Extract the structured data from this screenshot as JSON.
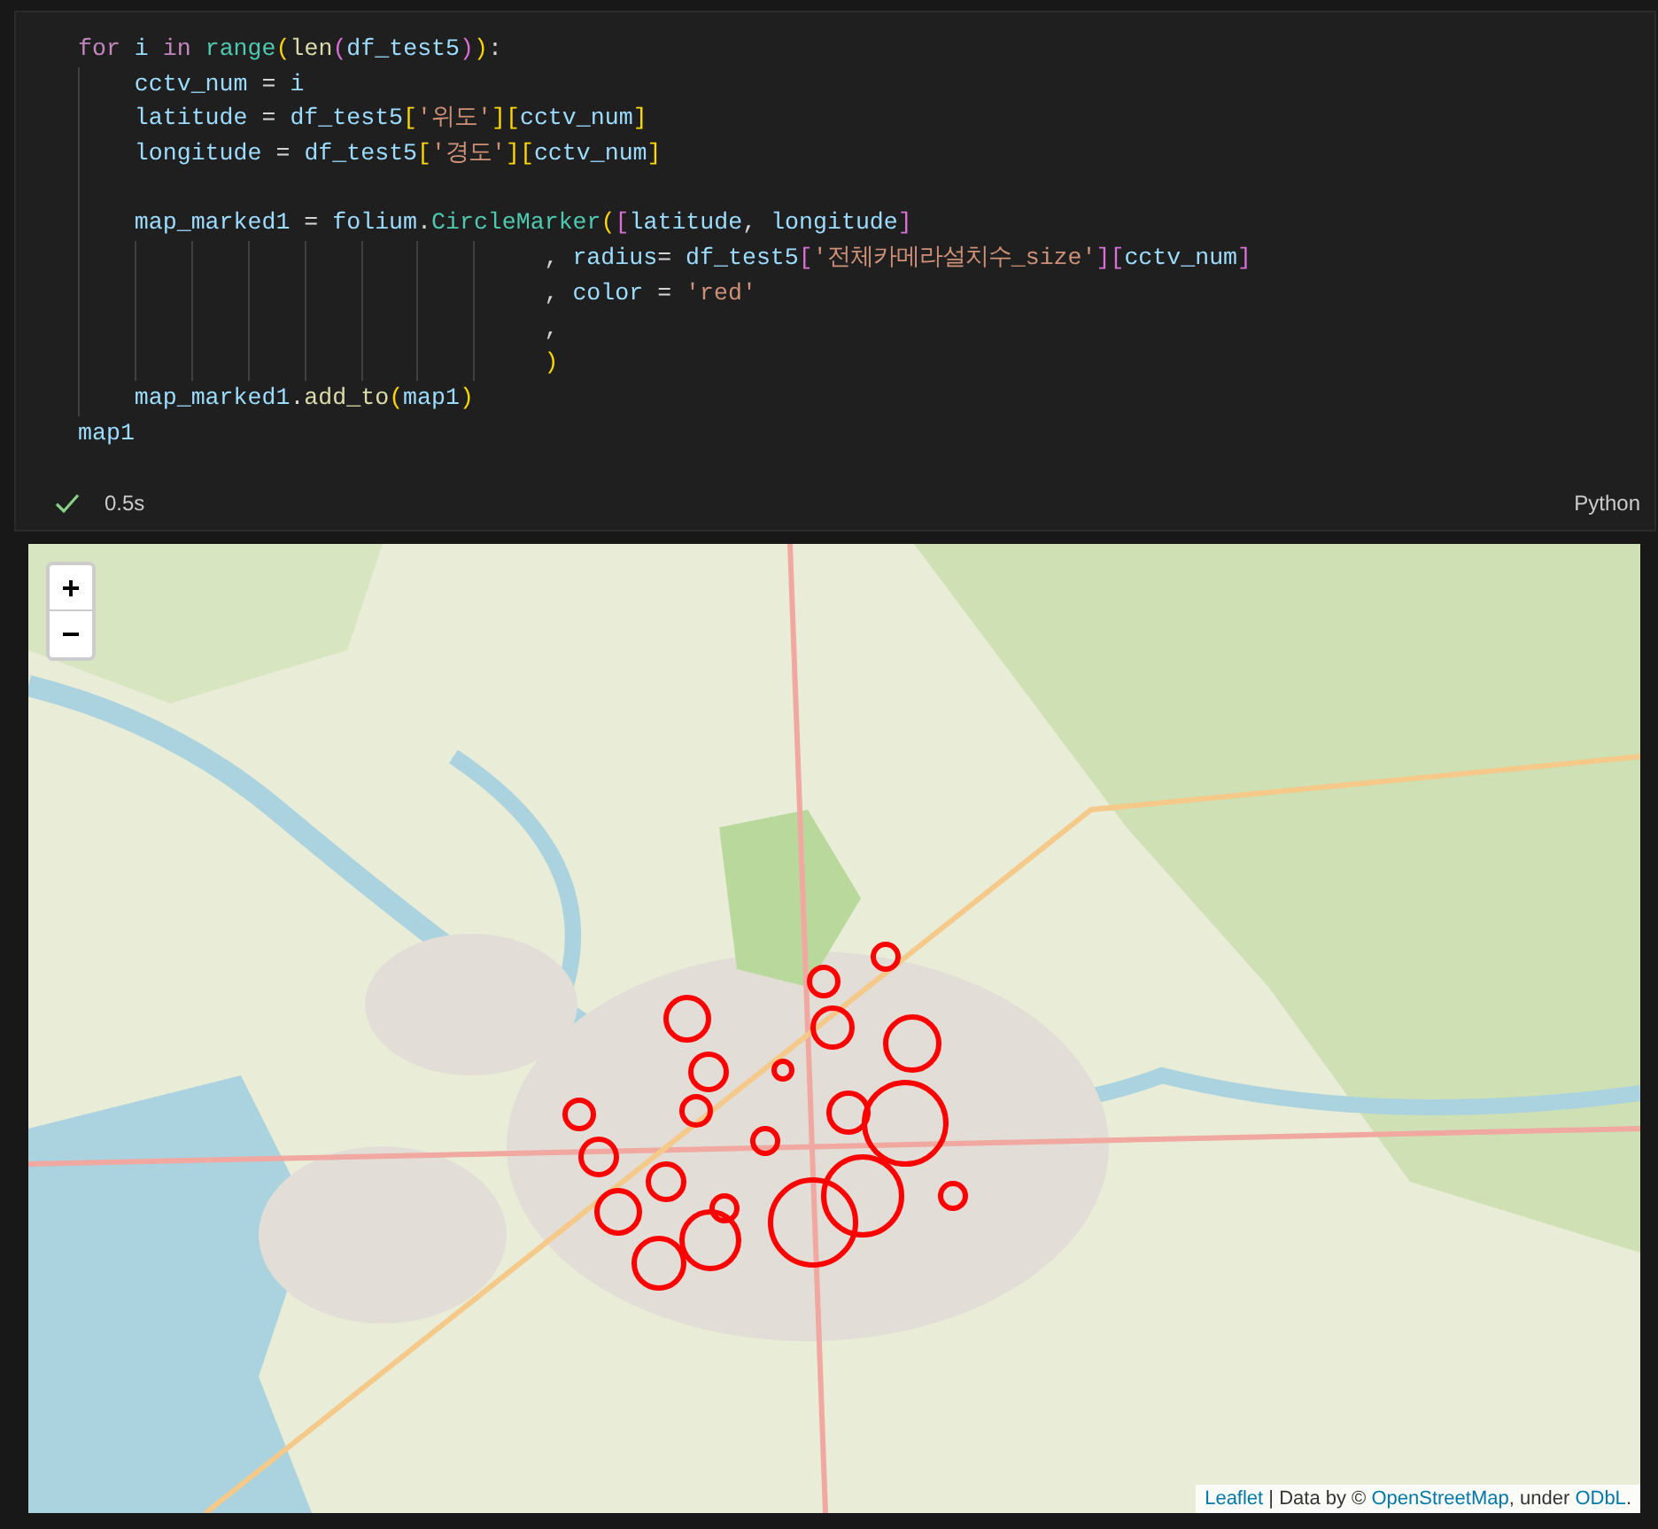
{
  "code": {
    "lines": [
      {
        "kind": "top",
        "tokens": [
          {
            "kind": "kw",
            "text": "for "
          },
          {
            "kind": "var",
            "text": "i "
          },
          {
            "kind": "kw",
            "text": "in "
          },
          {
            "kind": "cls",
            "text": "range"
          },
          {
            "kind": "b1",
            "text": "("
          },
          {
            "kind": "fn",
            "text": "len"
          },
          {
            "kind": "b2",
            "text": "("
          },
          {
            "kind": "var",
            "text": "df_test5"
          },
          {
            "kind": "b2",
            "text": ")"
          },
          {
            "kind": "b1",
            "text": ")"
          },
          {
            "kind": "op",
            "text": ":"
          }
        ]
      },
      {
        "kind": "body",
        "tokens": [
          {
            "kind": "var",
            "text": "cctv_num"
          },
          {
            "kind": "op",
            "text": " = "
          },
          {
            "kind": "var",
            "text": "i"
          }
        ]
      },
      {
        "kind": "body",
        "tokens": [
          {
            "kind": "var",
            "text": "latitude"
          },
          {
            "kind": "op",
            "text": " = "
          },
          {
            "kind": "var",
            "text": "df_test5"
          },
          {
            "kind": "b1",
            "text": "["
          },
          {
            "kind": "str",
            "text": "'위도'"
          },
          {
            "kind": "b1",
            "text": "]"
          },
          {
            "kind": "b1",
            "text": "["
          },
          {
            "kind": "var",
            "text": "cctv_num"
          },
          {
            "kind": "b1",
            "text": "]"
          }
        ]
      },
      {
        "kind": "body",
        "tokens": [
          {
            "kind": "var",
            "text": "longitude"
          },
          {
            "kind": "op",
            "text": " = "
          },
          {
            "kind": "var",
            "text": "df_test5"
          },
          {
            "kind": "b1",
            "text": "["
          },
          {
            "kind": "str",
            "text": "'경도'"
          },
          {
            "kind": "b1",
            "text": "]"
          },
          {
            "kind": "b1",
            "text": "["
          },
          {
            "kind": "var",
            "text": "cctv_num"
          },
          {
            "kind": "b1",
            "text": "]"
          }
        ]
      },
      {
        "kind": "blank"
      },
      {
        "kind": "body",
        "tokens": [
          {
            "kind": "var",
            "text": "map_marked1"
          },
          {
            "kind": "op",
            "text": " = "
          },
          {
            "kind": "var",
            "text": "folium"
          },
          {
            "kind": "op",
            "text": "."
          },
          {
            "kind": "cls",
            "text": "CircleMarker"
          },
          {
            "kind": "b1",
            "text": "("
          },
          {
            "kind": "b2",
            "text": "["
          },
          {
            "kind": "var",
            "text": "latitude"
          },
          {
            "kind": "op",
            "text": ", "
          },
          {
            "kind": "var",
            "text": "longitude"
          },
          {
            "kind": "b2",
            "text": "]"
          }
        ]
      },
      {
        "kind": "continuation",
        "tokens": [
          {
            "kind": "op",
            "text": ", "
          },
          {
            "kind": "var",
            "text": "radius"
          },
          {
            "kind": "op",
            "text": "= "
          },
          {
            "kind": "var",
            "text": "df_test5"
          },
          {
            "kind": "b2",
            "text": "["
          },
          {
            "kind": "str",
            "text": "'전체카메라설치수_size'"
          },
          {
            "kind": "b2",
            "text": "]"
          },
          {
            "kind": "b2",
            "text": "["
          },
          {
            "kind": "var",
            "text": "cctv_num"
          },
          {
            "kind": "b2",
            "text": "]"
          }
        ]
      },
      {
        "kind": "continuation",
        "tokens": [
          {
            "kind": "op",
            "text": ", "
          },
          {
            "kind": "var",
            "text": "color"
          },
          {
            "kind": "op",
            "text": " = "
          },
          {
            "kind": "str",
            "text": "'red'"
          }
        ]
      },
      {
        "kind": "continuation",
        "tokens": [
          {
            "kind": "op",
            "text": ","
          }
        ]
      },
      {
        "kind": "continuation",
        "tokens": [
          {
            "kind": "b1",
            "text": ")"
          }
        ]
      },
      {
        "kind": "body",
        "tokens": [
          {
            "kind": "var",
            "text": "map_marked1"
          },
          {
            "kind": "op",
            "text": "."
          },
          {
            "kind": "fn",
            "text": "add_to"
          },
          {
            "kind": "b1",
            "text": "("
          },
          {
            "kind": "var",
            "text": "map1"
          },
          {
            "kind": "b1",
            "text": ")"
          }
        ]
      },
      {
        "kind": "top",
        "tokens": [
          {
            "kind": "var",
            "text": "map1"
          }
        ]
      }
    ]
  },
  "status": {
    "succeeded": true,
    "time": "0.5s",
    "language": "Python"
  },
  "map": {
    "zoom_in": "+",
    "zoom_out": "−",
    "attribution": [
      {
        "kind": "link",
        "text": "Leaflet"
      },
      {
        "kind": "text",
        "text": " | Data by © "
      },
      {
        "kind": "link",
        "text": "OpenStreetMap"
      },
      {
        "kind": "text",
        "text": ", under "
      },
      {
        "kind": "link",
        "text": "ODbL"
      },
      {
        "kind": "text",
        "text": "."
      }
    ]
  }
}
